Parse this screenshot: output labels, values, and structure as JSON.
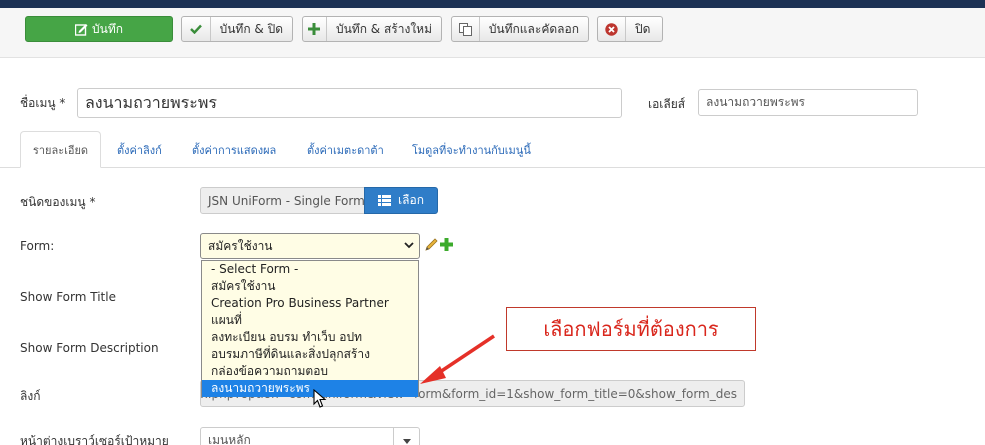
{
  "toolbar": {
    "save": "บันทึก",
    "save_close": "บันทึก & ปิด",
    "save_new": "บันทึก & สร้างใหม่",
    "save_copy": "บันทึกและคัดลอก",
    "close": "ปิด"
  },
  "title_field": {
    "label": "ชื่อเมนู *",
    "value": "ลงนามถวายพระพร"
  },
  "alias_field": {
    "label": "เอเลียส์",
    "value": "ลงนามถวายพระพร"
  },
  "tabs": [
    "รายละเอียด",
    "ตั้งค่าลิงก์",
    "ตั้งค่าการแสดงผล",
    "ตั้งค่าเมตะดาต้า",
    "โมดูลที่จะทำงานกับเมนูนี้"
  ],
  "menu_type": {
    "label": "ชนิดของเมนู *",
    "value": "JSN UniForm - Single Form",
    "button": "เลือก"
  },
  "form_field": {
    "label": "Form:",
    "value": "สมัครใช้งาน",
    "options": [
      "- Select Form -",
      "สมัครใช้งาน",
      "Creation Pro Business Partner",
      "แผนที่",
      "ลงทะเบียน อบรม ทำเว็บ อปท",
      "อบรมภาษีที่ดินและสิ่งปลุกสร้าง",
      "กล่องข้อความถามตอบ",
      "ลงนามถวายพระพร"
    ],
    "selected_index": 7
  },
  "show_form_title": {
    "label": "Show Form Title"
  },
  "show_form_desc": {
    "label": "Show Form Description"
  },
  "link_field": {
    "label": "ลิงก์",
    "value": "index.php?option=com_uniform&view=form&form_id=1&show_form_title=0&show_form_des"
  },
  "target_window": {
    "label": "หน้าต่างเบราว์เซอร์เป้าหมาย",
    "value": "เมนหลัก"
  },
  "annotation": {
    "text": "เลือกฟอร์มที่ต้องการ"
  },
  "colors": {
    "topbar": "#1c3154",
    "save_green": "#46a546",
    "primary_blue": "#2a69b8",
    "selected_option": "#1e82e6",
    "annotation_red": "#d9261c"
  }
}
